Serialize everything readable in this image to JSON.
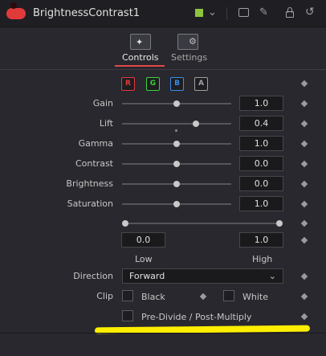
{
  "header": {
    "title": "BrightnessContrast1",
    "swatch_color": "#8ec33e",
    "icons": [
      "window-icon",
      "pin-icon",
      "lock-icon",
      "reset-icon"
    ]
  },
  "tabs": [
    {
      "label": "Controls",
      "icon": "controls-wand-icon",
      "active": true
    },
    {
      "label": "Settings",
      "icon": "settings-gear-icon",
      "active": false
    }
  ],
  "channels": [
    {
      "label": "R",
      "color": "#e03a3a"
    },
    {
      "label": "G",
      "color": "#3ad13a"
    },
    {
      "label": "B",
      "color": "#3a8ee8"
    },
    {
      "label": "A",
      "color": "#a0a0a0"
    }
  ],
  "sliders": [
    {
      "label": "Gain",
      "value": "1.0",
      "position": 0.5
    },
    {
      "label": "Lift",
      "value": "0.4",
      "position": 0.68
    },
    {
      "label": "Gamma",
      "value": "1.0",
      "position": 0.5
    },
    {
      "label": "Contrast",
      "value": "0.0",
      "position": 0.5
    },
    {
      "label": "Brightness",
      "value": "0.0",
      "position": 0.5
    },
    {
      "label": "Saturation",
      "value": "1.0",
      "position": 0.5
    }
  ],
  "range": {
    "low_value": "0.0",
    "high_value": "1.0",
    "low_label": "Low",
    "high_label": "High"
  },
  "direction": {
    "label": "Direction",
    "value": "Forward"
  },
  "clip": {
    "label": "Clip",
    "black_label": "Black",
    "white_label": "White"
  },
  "predivide": {
    "label": "Pre-Divide / Post-Multiply"
  }
}
